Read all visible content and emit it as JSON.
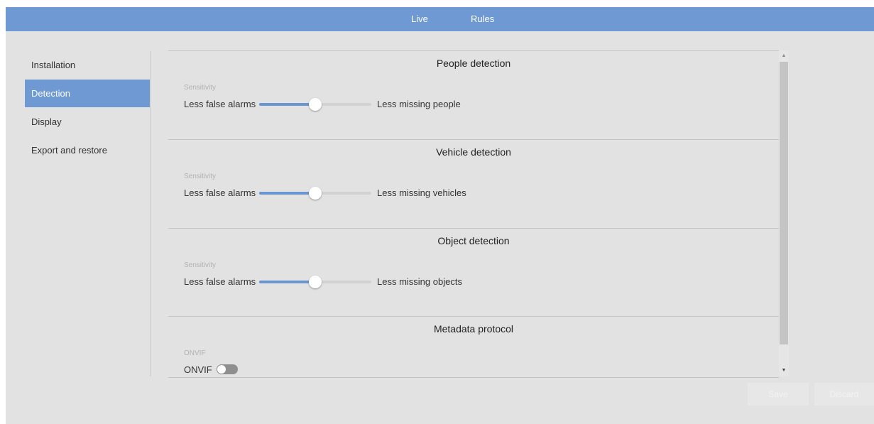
{
  "topbar": {
    "nav": [
      "Live",
      "Rules"
    ]
  },
  "sidebar": {
    "items": [
      {
        "label": "Installation"
      },
      {
        "label": "Detection"
      },
      {
        "label": "Display"
      },
      {
        "label": "Export and restore"
      }
    ],
    "active": "Detection"
  },
  "sections": {
    "people": {
      "title": "People detection",
      "field_label": "Sensitivity",
      "left": "Less false alarms",
      "right": "Less missing people",
      "value": 0.5
    },
    "vehicle": {
      "title": "Vehicle detection",
      "field_label": "Sensitivity",
      "left": "Less false alarms",
      "right": "Less missing vehicles",
      "value": 0.5
    },
    "object": {
      "title": "Object detection",
      "field_label": "Sensitivity",
      "left": "Less false alarms",
      "right": "Less missing objects",
      "value": 0.5
    },
    "metadata": {
      "title": "Metadata protocol",
      "field_label": "ONVIF",
      "toggle_label": "ONVIF",
      "enabled": false
    }
  },
  "buttons": {
    "save": "Save",
    "discard": "Discard"
  },
  "colors": {
    "accent": "#6e99d2",
    "background": "#e2e2e2"
  }
}
